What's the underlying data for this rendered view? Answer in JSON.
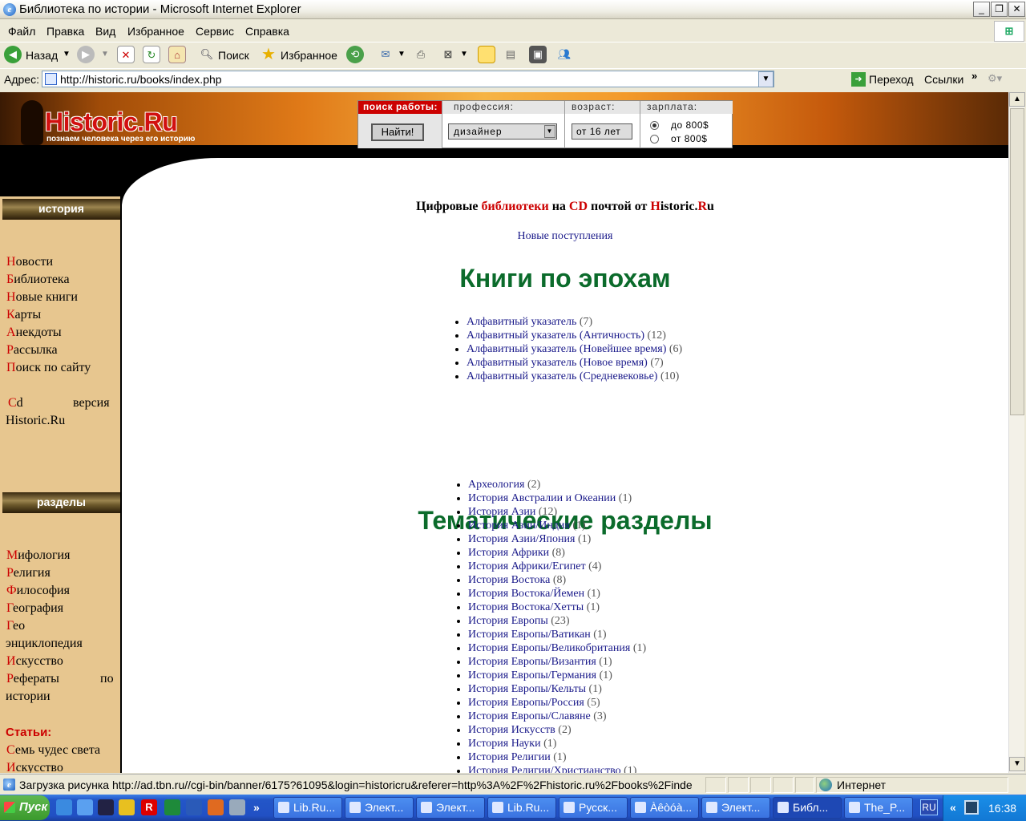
{
  "window": {
    "title": "Библиотека по истории - Microsoft Internet Explorer"
  },
  "menu": [
    "Файл",
    "Правка",
    "Вид",
    "Избранное",
    "Сервис",
    "Справка"
  ],
  "toolbar": {
    "back": "Назад",
    "search": "Поиск",
    "favorites": "Избранное"
  },
  "address": {
    "label": "Адрес:",
    "url": "http://historic.ru/books/index.php",
    "go": "Переход",
    "links": "Ссылки"
  },
  "banner": {
    "logo": "Historic.Ru",
    "tagline": "познаем человека через его историю",
    "job": {
      "header_search": "поиск работы:",
      "header_prof": "профессия:",
      "header_age": "возраст:",
      "header_salary": "зарплата:",
      "find_button": "Найти!",
      "profession": "дизайнер",
      "age": "от 16 лет",
      "salary_options": [
        "до 800$",
        "от 800$"
      ],
      "salary_selected": "до 800$"
    }
  },
  "sidebar": {
    "history_title": "история",
    "history_items": [
      {
        "first": "Н",
        "rest": "овости"
      },
      {
        "first": "Б",
        "rest": "иблиотека"
      },
      {
        "first": "Н",
        "rest": "овые книги"
      },
      {
        "first": "К",
        "rest": "арты"
      },
      {
        "first": "А",
        "rest": "некдоты"
      },
      {
        "first": "Р",
        "rest": "ассылка"
      },
      {
        "first": "П",
        "rest": "оиск по сайту"
      }
    ],
    "cd_first": "C",
    "cd_rest": "d",
    "cd_word2": "версия",
    "cd_line2": "Historic.Ru",
    "sections_title": "разделы",
    "section_items": [
      {
        "first": "М",
        "rest": "ифология"
      },
      {
        "first": "Р",
        "rest": "елигия"
      },
      {
        "first": "Ф",
        "rest": "илософия"
      },
      {
        "first": "Г",
        "rest": "еография"
      },
      {
        "first": "Г",
        "rest": "ео"
      }
    ],
    "geo_line2": "энциклопедия",
    "art": {
      "first": "И",
      "rest": "скусство"
    },
    "ref_first": "Р",
    "ref_rest": "ефераты",
    "ref_po": "по",
    "ref_line2": "истории",
    "articles": "Статьи:",
    "wonders": {
      "first": "С",
      "rest": "емь чудес света"
    },
    "last": {
      "first": "И",
      "rest": "скусство"
    }
  },
  "main": {
    "cd_parts": [
      "Цифровые ",
      "библиотеки",
      " на ",
      "CD",
      " почтой от ",
      "H",
      "istoric.",
      "R",
      "u"
    ],
    "new_link": "Новые поступления",
    "eras_title": "Книги по эпохам",
    "eras": [
      {
        "t": "Алфавитный указатель",
        "c": "(7)"
      },
      {
        "t": "Алфавитный указатель (Античность)",
        "c": "(12)"
      },
      {
        "t": "Алфавитный указатель (Новейшее время)",
        "c": "(6)"
      },
      {
        "t": "Алфавитный указатель (Новое время)",
        "c": "(7)"
      },
      {
        "t": "Алфавитный указатель (Средневековье)",
        "c": "(10)"
      }
    ],
    "topics_title": "Тематические разделы",
    "topics": [
      {
        "t": "Археология",
        "c": "(2)"
      },
      {
        "t": "История Австралии и Океании",
        "c": "(1)"
      },
      {
        "t": "История Азии",
        "c": "(12)"
      },
      {
        "t": "История Азии/Индия",
        "c": "(1)"
      },
      {
        "t": "История Азии/Япония",
        "c": "(1)"
      },
      {
        "t": "История Африки",
        "c": "(8)"
      },
      {
        "t": "История Африки/Египет",
        "c": "(4)"
      },
      {
        "t": "История Востока",
        "c": "(8)"
      },
      {
        "t": "История Востока/Йемен",
        "c": "(1)"
      },
      {
        "t": "История Востока/Хетты",
        "c": "(1)"
      },
      {
        "t": "История Европы",
        "c": "(23)"
      },
      {
        "t": "История Европы/Ватикан",
        "c": "(1)"
      },
      {
        "t": "История Европы/Великобритания",
        "c": "(1)"
      },
      {
        "t": "История Европы/Византия",
        "c": "(1)"
      },
      {
        "t": "История Европы/Германия",
        "c": "(1)"
      },
      {
        "t": "История Европы/Кельты",
        "c": "(1)"
      },
      {
        "t": "История Европы/Россия",
        "c": "(5)"
      },
      {
        "t": "История Европы/Славяне",
        "c": "(3)"
      },
      {
        "t": "История Искусств",
        "c": "(2)"
      },
      {
        "t": "История Науки",
        "c": "(1)"
      },
      {
        "t": "История Религии",
        "c": "(1)"
      },
      {
        "t": "История Религии/Христианство",
        "c": "(1)"
      }
    ]
  },
  "status": {
    "text": "Загрузка рисунка http://ad.tbn.ru//cgi-bin/banner/6175?61095&login=historicru&referer=http%3A%2F%2Fhistoric.ru%2Fbooks%2Finde",
    "zone": "Интернет"
  },
  "taskbar": {
    "start": "Пуск",
    "tasks": [
      {
        "label": "Lib.Ru..."
      },
      {
        "label": "Элект..."
      },
      {
        "label": "Элект..."
      },
      {
        "label": "Lib.Ru..."
      },
      {
        "label": "Русск..."
      },
      {
        "label": "Àêòóà..."
      },
      {
        "label": "Элект..."
      },
      {
        "label": "Библ...",
        "active": true
      },
      {
        "label": "The_P..."
      }
    ],
    "lang": "RU",
    "clock": "16:38"
  },
  "colors": {
    "nav_red": "#cc0000",
    "heading_green": "#0b6b2b",
    "link_blue": "#1a1a8a",
    "sidebar_bg": "#e7c68f"
  }
}
